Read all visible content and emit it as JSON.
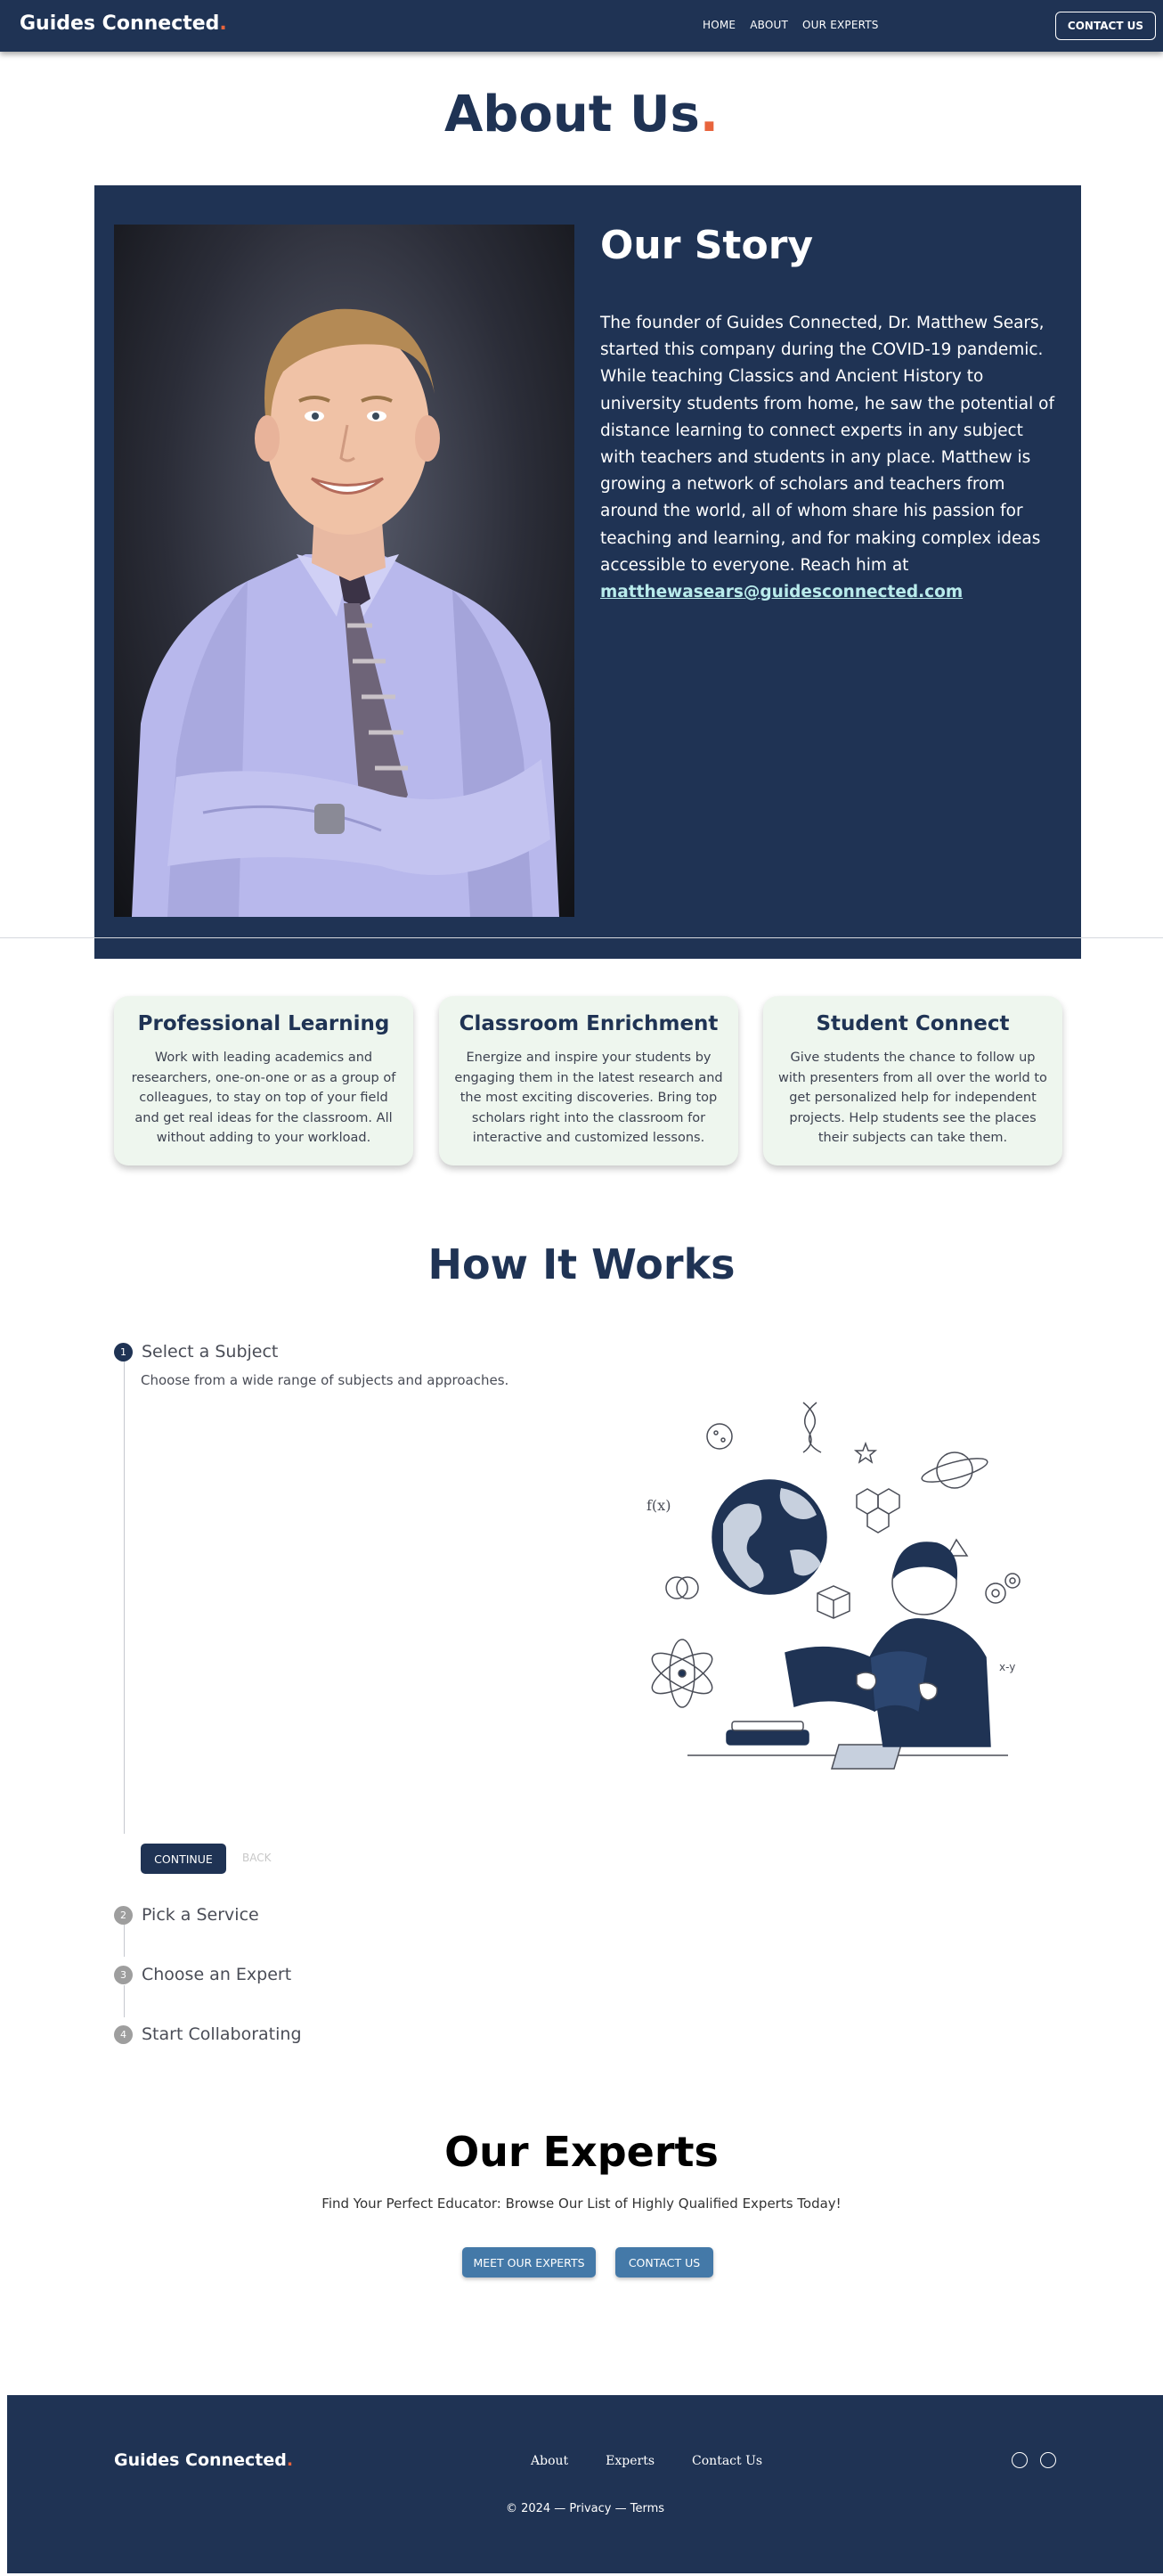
{
  "nav": {
    "brand": "Guides Connected",
    "brand_dot": ".",
    "links": [
      "HOME",
      "ABOUT",
      "OUR EXPERTS"
    ],
    "cta": "CONTACT US"
  },
  "hero": {
    "title": "About Us",
    "title_dot": "."
  },
  "story": {
    "heading": "Our Story",
    "body": "The founder of Guides Connected, Dr. Matthew Sears, started this company during the COVID-19 pandemic. While teaching Classics and Ancient History to university students from home, he saw the potential of distance learning to connect experts in any subject with teachers and students in any place. Matthew is growing a network of scholars and teachers from around the world, all of whom share his passion for teaching and learning, and for making complex ideas accessible to everyone. Reach him at ",
    "email": "matthewasears@guidesconnected.com"
  },
  "features": [
    {
      "title": "Professional Learning",
      "text": "Work with leading academics and researchers, one-on-one or as a group of colleagues, to stay on top of your field and get real ideas for the classroom. All without adding to your workload."
    },
    {
      "title": "Classroom Enrichment",
      "text": "Energize and inspire your students by engaging them in the latest research and the most exciting discoveries. Bring top scholars right into the classroom for interactive and customized lessons."
    },
    {
      "title": "Student Connect",
      "text": "Give students the chance to follow up with presenters from all over the world to get personalized help for independent projects. Help students see the places their subjects can take them."
    }
  ],
  "how": {
    "title": "How It Works",
    "steps": [
      {
        "num": "1",
        "label": "Select a Subject",
        "desc": "Choose from a wide range of subjects and approaches."
      },
      {
        "num": "2",
        "label": "Pick a Service"
      },
      {
        "num": "3",
        "label": "Choose an Expert"
      },
      {
        "num": "4",
        "label": "Start Collaborating"
      }
    ],
    "continue": "CONTINUE",
    "back": "BACK",
    "illustration_math_1": "f(x)",
    "illustration_math_2": "x-y"
  },
  "experts": {
    "title": "Our Experts",
    "subtitle": "Find Your Perfect Educator: Browse Our List of Highly Qualified Experts Today!",
    "btn_meet": "MEET OUR EXPERTS",
    "btn_contact": "CONTACT US"
  },
  "footer": {
    "brand": "Guides Connected",
    "brand_dot": ".",
    "links": [
      "About",
      "Experts",
      "Contact Us"
    ],
    "copyright": "© 2024 — Privacy — Terms",
    "social_icons": [
      "circle-icon",
      "circle-icon"
    ]
  },
  "colors": {
    "navy": "#1f3354",
    "accent": "#e8643c",
    "button_blue": "#4479a8",
    "card_bg": "#eef6ee"
  }
}
